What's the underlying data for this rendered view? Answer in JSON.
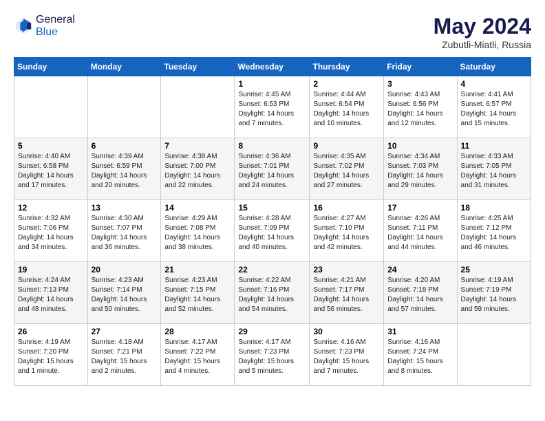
{
  "header": {
    "logo_general": "General",
    "logo_blue": "Blue",
    "month_year": "May 2024",
    "location": "Zubutli-Miatli, Russia"
  },
  "days_of_week": [
    "Sunday",
    "Monday",
    "Tuesday",
    "Wednesday",
    "Thursday",
    "Friday",
    "Saturday"
  ],
  "weeks": [
    [
      {
        "day": "",
        "info": ""
      },
      {
        "day": "",
        "info": ""
      },
      {
        "day": "",
        "info": ""
      },
      {
        "day": "1",
        "info": "Sunrise: 4:45 AM\nSunset: 6:53 PM\nDaylight: 14 hours and 7 minutes."
      },
      {
        "day": "2",
        "info": "Sunrise: 4:44 AM\nSunset: 6:54 PM\nDaylight: 14 hours and 10 minutes."
      },
      {
        "day": "3",
        "info": "Sunrise: 4:43 AM\nSunset: 6:56 PM\nDaylight: 14 hours and 12 minutes."
      },
      {
        "day": "4",
        "info": "Sunrise: 4:41 AM\nSunset: 6:57 PM\nDaylight: 14 hours and 15 minutes."
      }
    ],
    [
      {
        "day": "5",
        "info": "Sunrise: 4:40 AM\nSunset: 6:58 PM\nDaylight: 14 hours and 17 minutes."
      },
      {
        "day": "6",
        "info": "Sunrise: 4:39 AM\nSunset: 6:59 PM\nDaylight: 14 hours and 20 minutes."
      },
      {
        "day": "7",
        "info": "Sunrise: 4:38 AM\nSunset: 7:00 PM\nDaylight: 14 hours and 22 minutes."
      },
      {
        "day": "8",
        "info": "Sunrise: 4:36 AM\nSunset: 7:01 PM\nDaylight: 14 hours and 24 minutes."
      },
      {
        "day": "9",
        "info": "Sunrise: 4:35 AM\nSunset: 7:02 PM\nDaylight: 14 hours and 27 minutes."
      },
      {
        "day": "10",
        "info": "Sunrise: 4:34 AM\nSunset: 7:03 PM\nDaylight: 14 hours and 29 minutes."
      },
      {
        "day": "11",
        "info": "Sunrise: 4:33 AM\nSunset: 7:05 PM\nDaylight: 14 hours and 31 minutes."
      }
    ],
    [
      {
        "day": "12",
        "info": "Sunrise: 4:32 AM\nSunset: 7:06 PM\nDaylight: 14 hours and 34 minutes."
      },
      {
        "day": "13",
        "info": "Sunrise: 4:30 AM\nSunset: 7:07 PM\nDaylight: 14 hours and 36 minutes."
      },
      {
        "day": "14",
        "info": "Sunrise: 4:29 AM\nSunset: 7:08 PM\nDaylight: 14 hours and 38 minutes."
      },
      {
        "day": "15",
        "info": "Sunrise: 4:28 AM\nSunset: 7:09 PM\nDaylight: 14 hours and 40 minutes."
      },
      {
        "day": "16",
        "info": "Sunrise: 4:27 AM\nSunset: 7:10 PM\nDaylight: 14 hours and 42 minutes."
      },
      {
        "day": "17",
        "info": "Sunrise: 4:26 AM\nSunset: 7:11 PM\nDaylight: 14 hours and 44 minutes."
      },
      {
        "day": "18",
        "info": "Sunrise: 4:25 AM\nSunset: 7:12 PM\nDaylight: 14 hours and 46 minutes."
      }
    ],
    [
      {
        "day": "19",
        "info": "Sunrise: 4:24 AM\nSunset: 7:13 PM\nDaylight: 14 hours and 48 minutes."
      },
      {
        "day": "20",
        "info": "Sunrise: 4:23 AM\nSunset: 7:14 PM\nDaylight: 14 hours and 50 minutes."
      },
      {
        "day": "21",
        "info": "Sunrise: 4:23 AM\nSunset: 7:15 PM\nDaylight: 14 hours and 52 minutes."
      },
      {
        "day": "22",
        "info": "Sunrise: 4:22 AM\nSunset: 7:16 PM\nDaylight: 14 hours and 54 minutes."
      },
      {
        "day": "23",
        "info": "Sunrise: 4:21 AM\nSunset: 7:17 PM\nDaylight: 14 hours and 56 minutes."
      },
      {
        "day": "24",
        "info": "Sunrise: 4:20 AM\nSunset: 7:18 PM\nDaylight: 14 hours and 57 minutes."
      },
      {
        "day": "25",
        "info": "Sunrise: 4:19 AM\nSunset: 7:19 PM\nDaylight: 14 hours and 59 minutes."
      }
    ],
    [
      {
        "day": "26",
        "info": "Sunrise: 4:19 AM\nSunset: 7:20 PM\nDaylight: 15 hours and 1 minute."
      },
      {
        "day": "27",
        "info": "Sunrise: 4:18 AM\nSunset: 7:21 PM\nDaylight: 15 hours and 2 minutes."
      },
      {
        "day": "28",
        "info": "Sunrise: 4:17 AM\nSunset: 7:22 PM\nDaylight: 15 hours and 4 minutes."
      },
      {
        "day": "29",
        "info": "Sunrise: 4:17 AM\nSunset: 7:23 PM\nDaylight: 15 hours and 5 minutes."
      },
      {
        "day": "30",
        "info": "Sunrise: 4:16 AM\nSunset: 7:23 PM\nDaylight: 15 hours and 7 minutes."
      },
      {
        "day": "31",
        "info": "Sunrise: 4:16 AM\nSunset: 7:24 PM\nDaylight: 15 hours and 8 minutes."
      },
      {
        "day": "",
        "info": ""
      }
    ]
  ]
}
